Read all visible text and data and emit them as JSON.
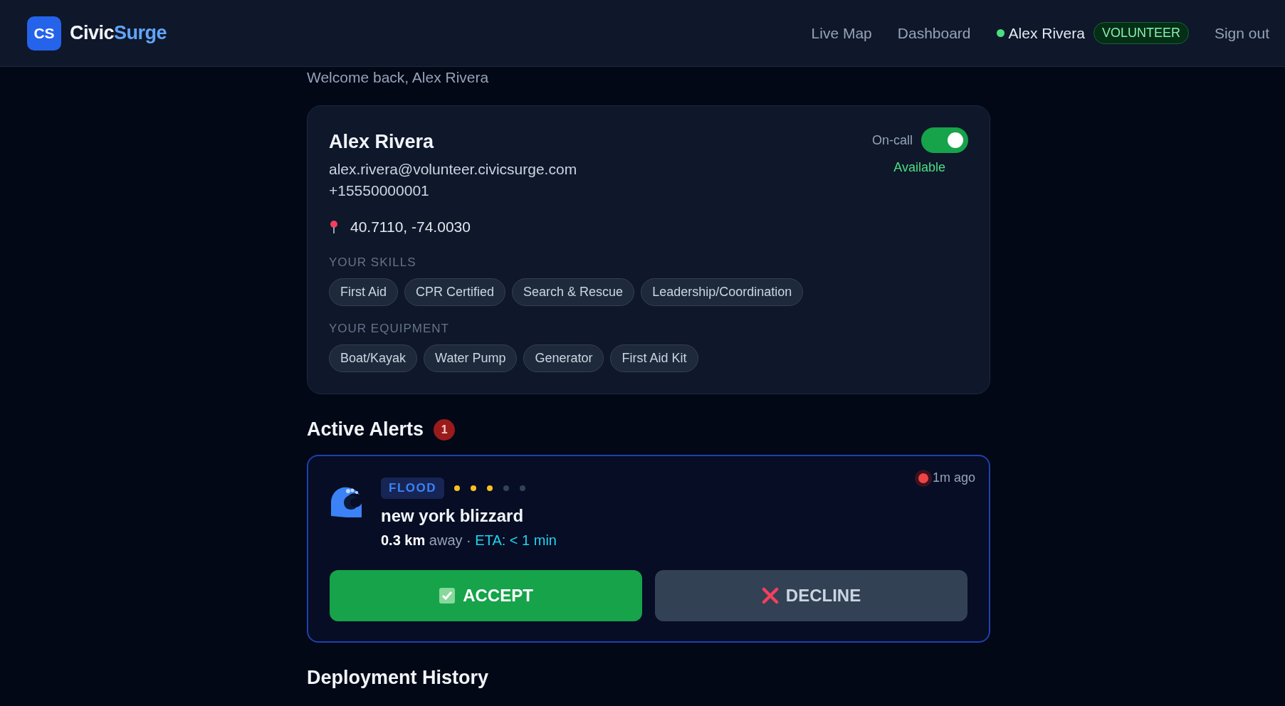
{
  "header": {
    "logo_initials": "CS",
    "brand_name": "Civic",
    "brand_accent": "Surge",
    "nav": [
      {
        "label": "Live Map"
      },
      {
        "label": "Dashboard"
      }
    ],
    "user": {
      "name": "Alex Rivera",
      "online": true,
      "role": "VOLUNTEER"
    },
    "sign_out": "Sign out"
  },
  "welcome": "Welcome back, Alex Rivera",
  "profile": {
    "name": "Alex Rivera",
    "email": "alex.rivera@volunteer.civicsurge.com",
    "phone": "+15550000001",
    "location": "40.7110, -74.0030",
    "on_call_label": "On-call",
    "on_call": true,
    "availability": "Available",
    "skills_label": "YOUR SKILLS",
    "skills": [
      "First Aid",
      "CPR Certified",
      "Search & Rescue",
      "Leadership/Coordination"
    ],
    "equipment_label": "YOUR EQUIPMENT",
    "equipment": [
      "Boat/Kayak",
      "Water Pump",
      "Generator",
      "First Aid Kit"
    ]
  },
  "alerts_heading": "Active Alerts",
  "alerts_count": "1",
  "alerts": [
    {
      "type": "FLOOD",
      "stars": 3,
      "title": "new york blizzard",
      "distance": "0.3 km",
      "distance_suffix": "away",
      "separator": "·",
      "eta": "ETA: < 1 min",
      "time": "1m ago",
      "live": true,
      "accept": "ACCEPT",
      "decline": "DECLINE"
    }
  ],
  "history_heading": "Deployment History"
}
